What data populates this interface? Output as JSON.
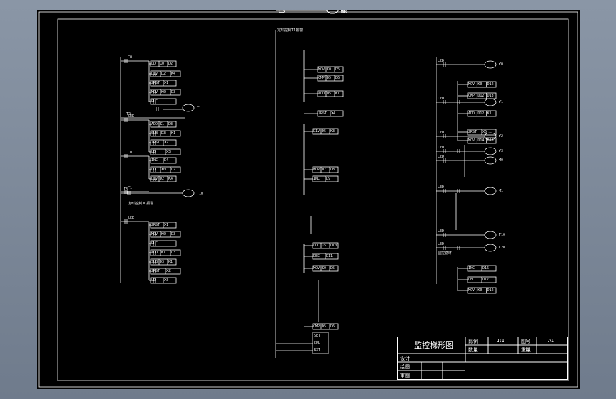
{
  "drawing": {
    "title_block": {
      "drawing_title": "监控梯形图",
      "scale_label": "比例",
      "scale_value": "1:1",
      "sheet_label": "图号",
      "sheet_value": "A1",
      "quantity_label": "数量",
      "weight_label": "重量",
      "designer_label": "设计",
      "drafter_label": "绘图",
      "reviewer_label": "审图"
    }
  },
  "colors": {
    "background": "#7d8999",
    "sheet": "#000000",
    "lines": "#ffffff"
  },
  "ladder": {
    "left_rung_labels": [
      "T0",
      "LED",
      "T0",
      "T1",
      "LED",
      "T2",
      "T3",
      "LED",
      "T4",
      "T2"
    ],
    "left_boxes": [
      "LD X0 D2",
      "DIV D2 K4",
      "ZRST X1",
      "MOV K0 D3",
      "PLC",
      "ADD K1 D3",
      "SUB D3 K1",
      "ZRST X2",
      "LD X3",
      "INC D4"
    ],
    "mid_boxes": [
      "MOV K0 D5",
      "CMP D5 D6",
      "ADD D5 K1",
      "ZRST X4",
      "DIV D5 K3",
      "MOV D7 D8",
      "INC D9",
      "LD X5 D10",
      "DEC D11"
    ],
    "right_boxes": [
      "MOV K0 D12",
      "CMP D12 D13",
      "ADD D12 K1",
      "ZRST X6",
      "MOV D14 D15",
      "INC D16",
      "DEC D17"
    ],
    "coils": [
      "Y0",
      "Y1",
      "Y2",
      "Y3",
      "M0",
      "M1",
      "T10",
      "T20"
    ],
    "notes": [
      "定时控制T0报警",
      "定时控制T1报警",
      "监控循环"
    ]
  }
}
